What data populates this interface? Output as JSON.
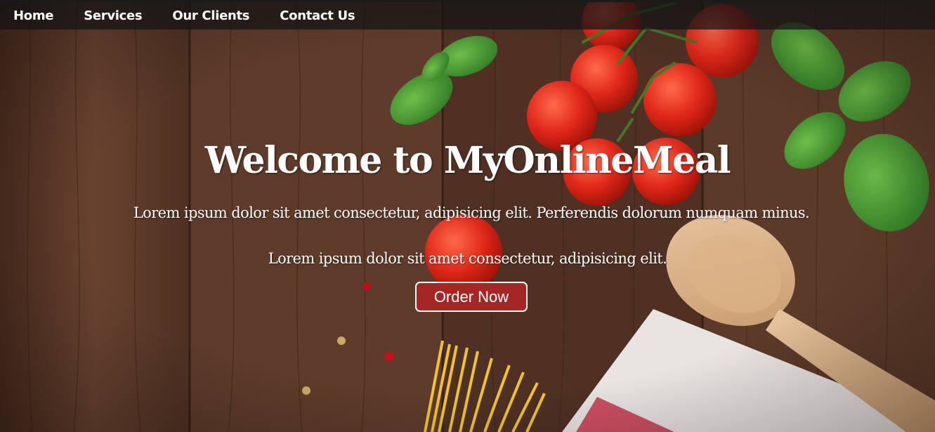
{
  "nav": {
    "items": [
      {
        "label": "Home"
      },
      {
        "label": "Services"
      },
      {
        "label": "Our Clients"
      },
      {
        "label": "Contact Us"
      }
    ]
  },
  "hero": {
    "title": "Welcome to MyOnlineMeal",
    "line1": "Lorem ipsum dolor sit amet consectetur, adipisicing elit. Perferendis dolorum numquam minus.",
    "line2": "Lorem ipsum dolor sit amet consectetur, adipisicing elit.",
    "button": "Order Now"
  },
  "colors": {
    "nav_bg": "#141414",
    "button_bg": "#a62624",
    "wood": "#5a3a28",
    "text": "#ffffff"
  },
  "icons": {
    "background": "wooden-table-food-photo"
  }
}
